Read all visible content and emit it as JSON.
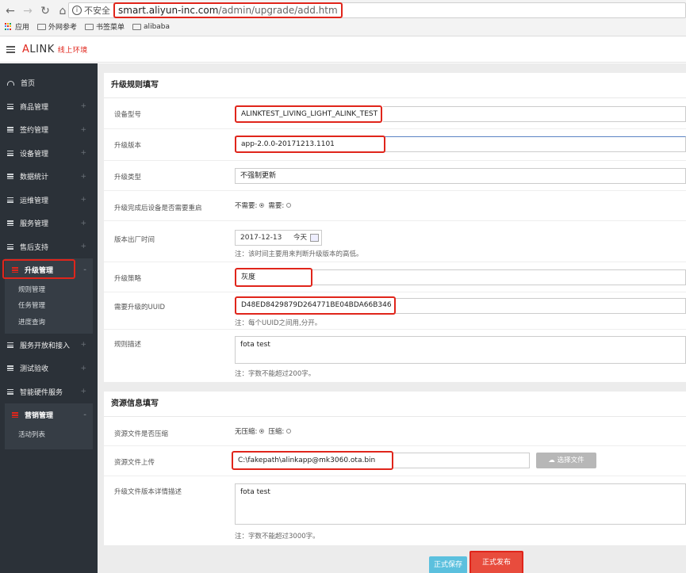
{
  "browser": {
    "insecure_label": "不安全",
    "url_domain": "smart.aliyun-inc.com",
    "url_path": "/admin/upgrade/add.htm",
    "bookmarks": [
      "应用",
      "外网参考",
      "书签菜单",
      "alibaba"
    ]
  },
  "app": {
    "logo_prefix": "A",
    "logo_main": "LINK",
    "logo_env": "线上环境"
  },
  "sidebar": {
    "home": "首页",
    "items_top": [
      "商品管理",
      "签约管理",
      "设备管理",
      "数据统计",
      "运维管理",
      "服务管理",
      "售后支持"
    ],
    "upgrade": {
      "label": "升级管理",
      "toggle": "-",
      "children": [
        "规则管理",
        "任务管理",
        "进度查询"
      ]
    },
    "items_mid": [
      "服务开放和接入",
      "测试验收",
      "智能硬件服务"
    ],
    "marketing": {
      "label": "营销管理",
      "toggle": "-",
      "children": [
        "活动列表"
      ]
    },
    "plus": "+"
  },
  "rules_form": {
    "title": "升级规则填写",
    "device_model": {
      "label": "设备型号",
      "value": "ALINKTEST_LIVING_LIGHT_ALINK_TEST"
    },
    "upgrade_version": {
      "label": "升级版本",
      "value": "app-2.0.0-20171213.1101"
    },
    "upgrade_type": {
      "label": "升级类型",
      "value": "不强制更新"
    },
    "reboot": {
      "label": "升级完成后设备是否需要重启",
      "options": [
        "不需要:",
        "需要:"
      ],
      "selected": 0
    },
    "release_time": {
      "label": "版本出厂时间",
      "value": "2017-12-13",
      "today": "今天",
      "note": "注：该时间主要用来判断升级版本的高低。"
    },
    "strategy": {
      "label": "升级策略",
      "value": "灰度"
    },
    "uuid": {
      "label": "需要升级的UUID",
      "value": "D48ED8429879D264771BE04BDA66B346",
      "note": "注：每个UUID之间用,分开。"
    },
    "description": {
      "label": "规则描述",
      "value": "fota test",
      "note": "注：字数不能超过200字。"
    }
  },
  "resource_form": {
    "title": "资源信息填写",
    "compressed": {
      "label": "资源文件是否压缩",
      "options": [
        "无压缩:",
        "压缩:"
      ],
      "selected": 0
    },
    "upload": {
      "label": "资源文件上传",
      "value": "C:\\fakepath\\alinkapp@mk3060.ota.bin",
      "button": "选择文件"
    },
    "detail": {
      "label": "升级文件版本详情描述",
      "value": "fota test",
      "note": "注：字数不能超过3000字。"
    }
  },
  "actions": {
    "save": "正式保存",
    "publish": "正式发布"
  },
  "colors": {
    "accent": "#e0251b",
    "save_btn": "#5bc0de",
    "publish_btn": "#e84c3d",
    "sidebar": "#2b3138"
  }
}
